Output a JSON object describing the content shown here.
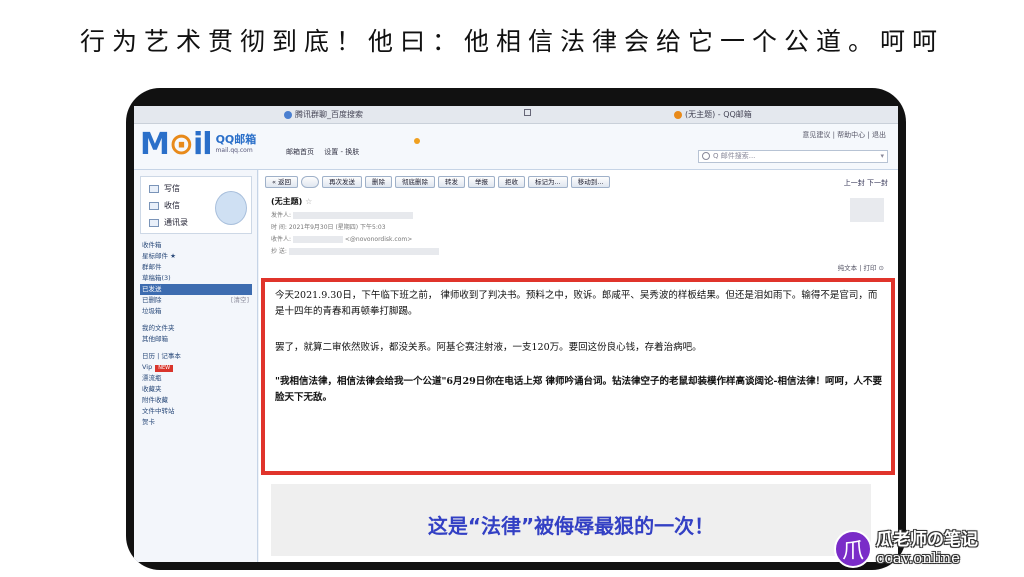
{
  "headline": "行为艺术贯彻到底！他曰：他相信法律会给它一个公道。呵呵",
  "browser": {
    "tab1": "腾讯群聊_百度搜索",
    "tab3": "(无主题) - QQ邮箱"
  },
  "header": {
    "logo_mail": "M",
    "logo_o": "⊙",
    "logo_il": "il",
    "logo_qq": "QQ邮箱",
    "logo_url": "mail.qq.com",
    "link_home": "邮箱首页",
    "link_settings": "设置 - 换肤",
    "right_links": "意见建议 | 帮助中心 | 退出",
    "search_placeholder": "Q 邮件搜索..."
  },
  "sidebar": {
    "quick": [
      "写信",
      "收信",
      "通讯录"
    ],
    "folders_a": [
      "收件箱",
      "星标邮件 ★",
      "群邮件",
      "草稿箱(3)"
    ],
    "folder_selected": "已发送",
    "folder_deleted": "已删除",
    "folder_deleted_right": "[清空]",
    "folder_trash": "垃圾箱",
    "folders_b": [
      "我的文件夹",
      "其他邮箱"
    ],
    "folders_c": [
      "日历 | 记事本",
      "Vip"
    ],
    "vip_badge": "NEW",
    "folders_d": [
      "漂流瓶",
      "收藏夹",
      "附件收藏",
      "文件中转站",
      "贺卡"
    ]
  },
  "toolbar": {
    "back": "« 返回",
    "buttons": [
      "再次发送",
      "删除",
      "彻底删除",
      "转发",
      "举报",
      "拒收",
      "标记为..."
    ],
    "mark": "标记为...",
    "move": "移动到...",
    "pager": "上一封 下一封"
  },
  "email": {
    "subject": "(无主题)",
    "star": "☆",
    "from_label": "发件人:",
    "time_line": "时 间: 2021年9月30日 (星期四) 下午5:03",
    "to_label": "收件人:",
    "to_suffix": "<@novonordisk.com>",
    "cc_label": "抄 送:",
    "view_links": "纯文本 | 打印 ⊙",
    "para1": "今天2021.9.30日，下午临下班之前，   律师收到了判决书。预料之中，败诉。郎咸平、吴秀波的样板结果。但还是泪如雨下。输得不是官司，而是十四年的青春和再顿拳打脚踢。",
    "para2": "罢了，就算二审依然败诉，都没关系。阿基仑赛注射液，一支120万。要回这份良心钱，存着治病吧。",
    "para3": "\"我相信法律，相信法律会给我一个公道\"6月29日你在电话上郑   律师吟诵台词。钻法律空子的老鼠却装模作样高谈阔论-相信法律！呵呵，人不要脸天下无敌。"
  },
  "caption": "这是“法律”被侮辱最狠的一次！",
  "watermark": {
    "icon": "爪",
    "line1": "瓜老师の笔记",
    "line2": "ccav.online"
  },
  "colors": {
    "highlight_border": "#e0342b",
    "caption_text": "#3340c4",
    "logo_blue": "#2a6fc9"
  }
}
